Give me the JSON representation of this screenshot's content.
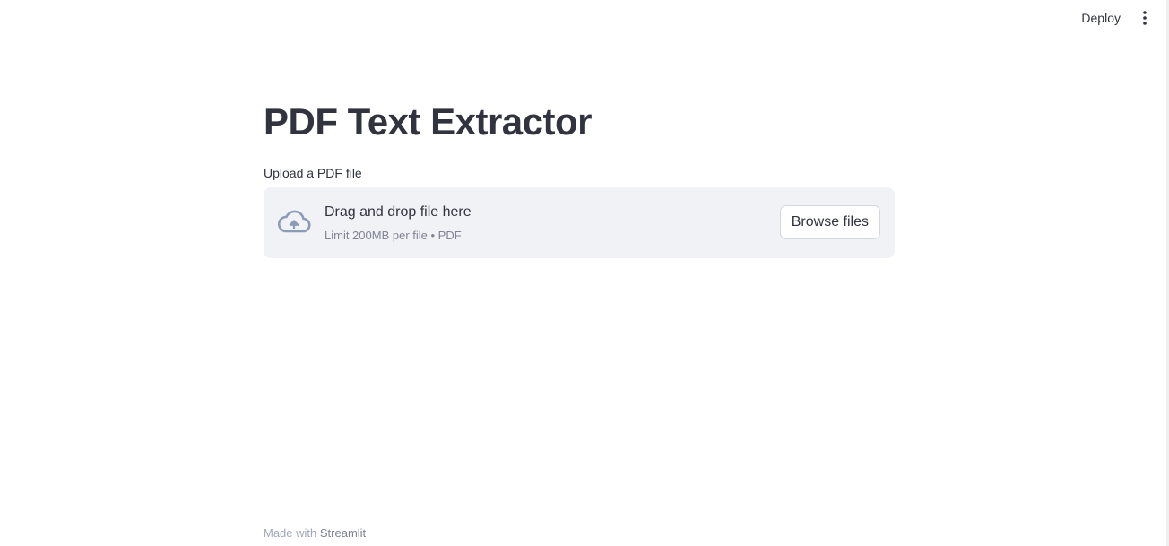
{
  "header": {
    "deploy_label": "Deploy",
    "menu_icon": "more-vertical-icon"
  },
  "main": {
    "title": "PDF Text Extractor",
    "uploader": {
      "label": "Upload a PDF file",
      "icon": "cloud-upload-icon",
      "drop_title": "Drag and drop file here",
      "drop_subtitle": "Limit 200MB per file • PDF",
      "browse_label": "Browse files"
    }
  },
  "footer": {
    "prefix": "Made with",
    "link_text": "Streamlit"
  },
  "colors": {
    "text": "#31333f",
    "dropzone_bg": "#f0f2f6",
    "muted": "#808495",
    "icon": "#8b9bb8"
  }
}
